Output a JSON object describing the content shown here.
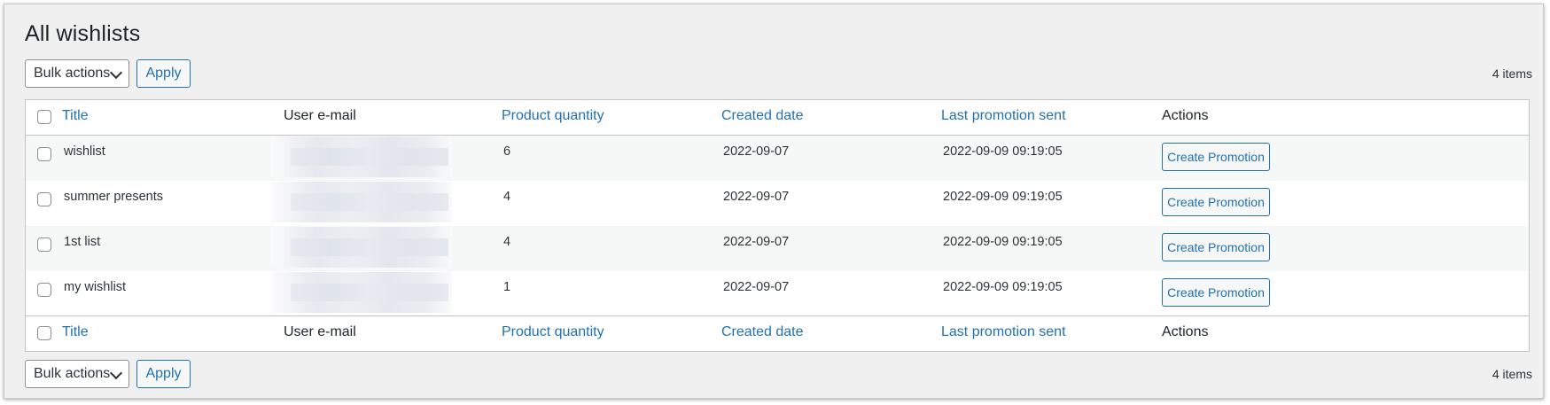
{
  "page": {
    "title": "All wishlists"
  },
  "tablenav_top": {
    "bulk_actions": "Bulk actions",
    "apply": "Apply",
    "count": "4 items"
  },
  "tablenav_bottom": {
    "bulk_actions": "Bulk actions",
    "apply": "Apply",
    "count": "4 items"
  },
  "columns": {
    "title": "Title",
    "email": "User e-mail",
    "quantity": "Product quantity",
    "created": "Created date",
    "last_promo": "Last promotion sent",
    "actions": "Actions"
  },
  "rows": [
    {
      "title": "wishlist",
      "email": "",
      "quantity": "6",
      "created": "2022-09-07",
      "last_promo": "2022-09-09 09:19:05",
      "action": "Create Promotion"
    },
    {
      "title": "summer presents",
      "email": "",
      "quantity": "4",
      "created": "2022-09-07",
      "last_promo": "2022-09-09 09:19:05",
      "action": "Create Promotion"
    },
    {
      "title": "1st list",
      "email": "",
      "quantity": "4",
      "created": "2022-09-07",
      "last_promo": "2022-09-09 09:19:05",
      "action": "Create Promotion"
    },
    {
      "title": "my wishlist",
      "email": "",
      "quantity": "1",
      "created": "2022-09-07",
      "last_promo": "2022-09-09 09:19:05",
      "action": "Create Promotion"
    }
  ],
  "colors": {
    "link": "#2271b1",
    "border": "#c3c4c7",
    "background": "#f0f0f1",
    "alt_row": "#f6f7f7"
  },
  "icons": {
    "dropdown": "chevron-down-icon"
  }
}
